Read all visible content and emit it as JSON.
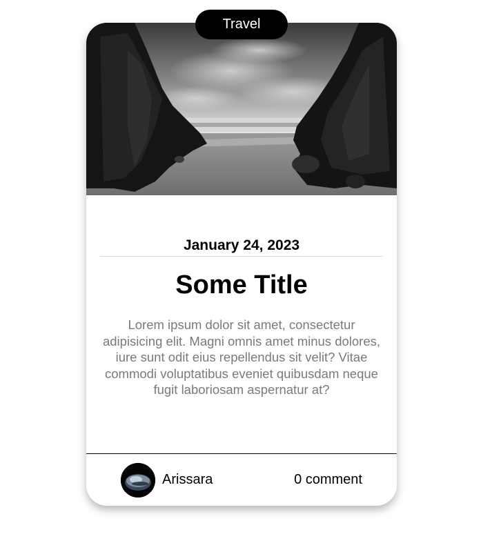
{
  "card": {
    "category": "Travel",
    "date": "January 24, 2023",
    "title": "Some Title",
    "excerpt": "Lorem ipsum dolor sit amet, consectetur adipisicing elit. Magni omnis amet minus dolores, iure sunt odit eius repellendus sit velit? Vitae commodi voluptatibus eveniet quibusdam neque fugit laboriosam aspernatur at?",
    "author": "Arissara",
    "comments": "0 comment",
    "image": "black-and-white beach between rock cliffs",
    "avatar": "dark planet photo"
  },
  "colors": {
    "pill_bg": "#000000",
    "excerpt_text": "#7a7a7a",
    "divider": "#000000"
  }
}
